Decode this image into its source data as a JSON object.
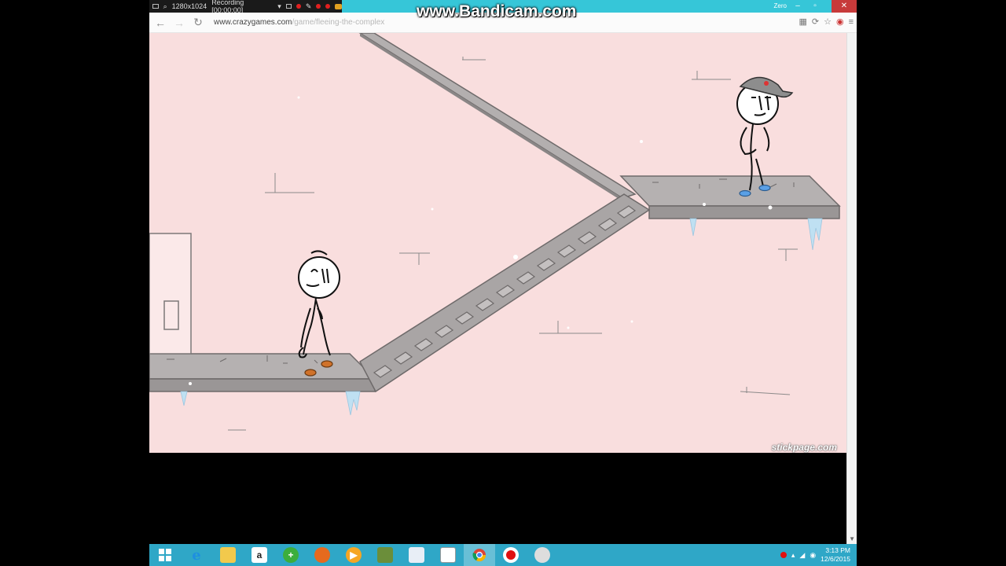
{
  "recorder": {
    "resolution": "1280x1024",
    "status": "Recording [00:00:00]"
  },
  "overlay": {
    "watermark": "www.Bandicam.com"
  },
  "window": {
    "user_chip": "Zero"
  },
  "browser": {
    "url_host": "www.crazygames.com",
    "url_path": "/game/fleeing-the-complex"
  },
  "game": {
    "site_watermark": "stickpage.com",
    "colors": {
      "background": "#f9dede",
      "platform": "#b5b1b1",
      "platform_edge": "#8c8888",
      "ice": "#b7d9ee",
      "guard_cap": "#8d8d8d",
      "henry_shoes": "#d0722a",
      "guard_shoes": "#5aa0e6"
    }
  },
  "taskbar": {
    "apps": [
      {
        "name": "start",
        "icon": "windows-start-icon"
      },
      {
        "name": "ie",
        "icon": "internet-explorer-icon"
      },
      {
        "name": "files",
        "icon": "file-explorer-icon"
      },
      {
        "name": "amazon",
        "icon": "amazon-icon"
      },
      {
        "name": "green-plus",
        "icon": "green-plus-icon"
      },
      {
        "name": "firefox",
        "icon": "firefox-icon"
      },
      {
        "name": "player",
        "icon": "media-player-icon"
      },
      {
        "name": "minecraft",
        "icon": "minecraft-icon"
      },
      {
        "name": "paint",
        "icon": "paint-icon"
      },
      {
        "name": "store",
        "icon": "store-icon"
      },
      {
        "name": "chrome",
        "icon": "chrome-icon",
        "active": true
      },
      {
        "name": "bandicam",
        "icon": "bandicam-icon"
      },
      {
        "name": "speaker-app",
        "icon": "speaker-app-icon"
      }
    ],
    "time": "3:13 PM",
    "date": "12/6/2015"
  }
}
